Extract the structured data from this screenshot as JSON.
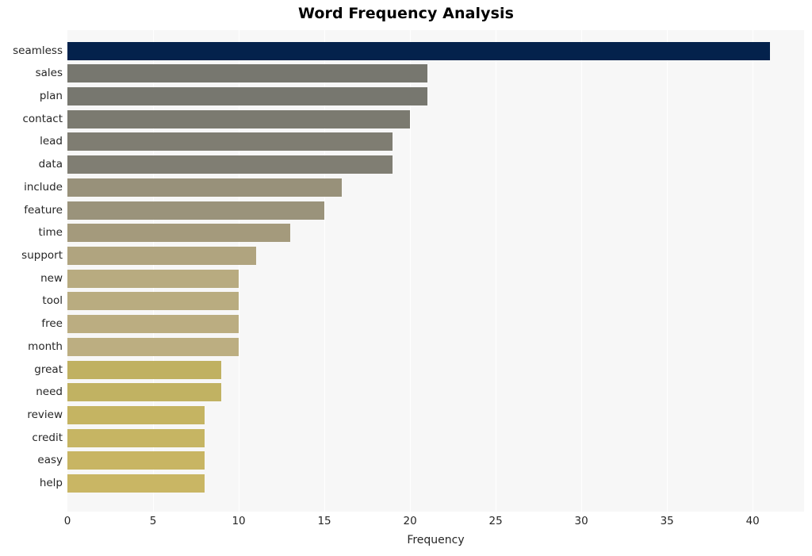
{
  "chart_data": {
    "type": "bar",
    "orientation": "horizontal",
    "title": "Word Frequency Analysis",
    "xlabel": "Frequency",
    "ylabel": "",
    "xlim": [
      0,
      43
    ],
    "ylim": null,
    "grid": true,
    "legend": null,
    "xticks": [
      0,
      5,
      10,
      15,
      20,
      25,
      30,
      35,
      40
    ],
    "xtick_labels": [
      "0",
      "5",
      "10",
      "15",
      "20",
      "25",
      "30",
      "35",
      "40"
    ],
    "categories": [
      "seamless",
      "sales",
      "plan",
      "contact",
      "lead",
      "data",
      "include",
      "feature",
      "time",
      "support",
      "new",
      "tool",
      "free",
      "month",
      "great",
      "need",
      "review",
      "credit",
      "easy",
      "help"
    ],
    "values": [
      41,
      21,
      21,
      20,
      19,
      19,
      16,
      15,
      13,
      11,
      10,
      10,
      10,
      10,
      9,
      9,
      8,
      8,
      8,
      8
    ],
    "bar_colors": [
      "#04224c",
      "#77776f",
      "#77776f",
      "#7b7a70",
      "#7f7d72",
      "#807e73",
      "#98917a",
      "#9a937b",
      "#a49a7c",
      "#b0a47f",
      "#b8ab80",
      "#b9ac80",
      "#bbad81",
      "#bcae81",
      "#c0b161",
      "#c1b262",
      "#c5b462",
      "#c6b563",
      "#c8b563",
      "#c9b664"
    ],
    "plot_background": "#f7f7f7",
    "figure_background": "#ffffff",
    "gridline_color": "#ffffff"
  }
}
